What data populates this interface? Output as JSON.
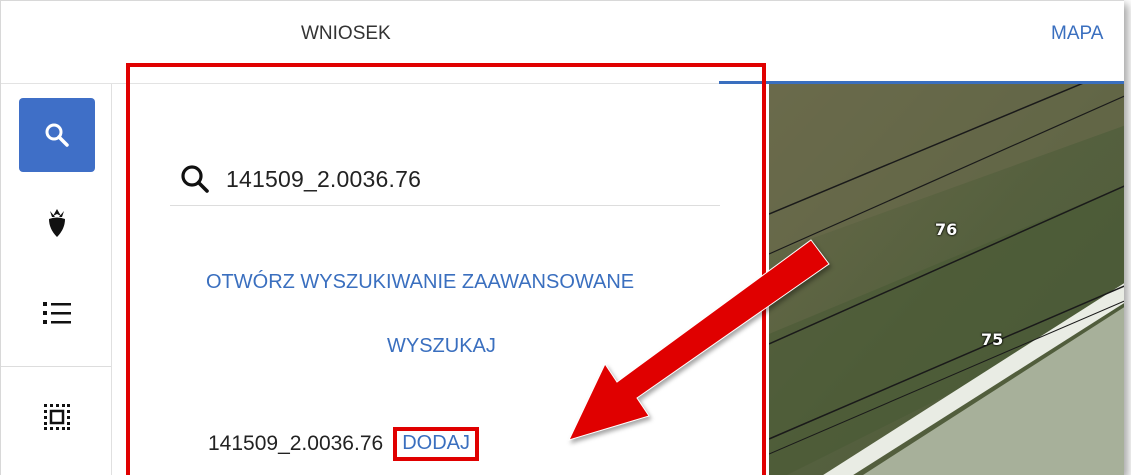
{
  "tabs": [
    {
      "label": "WNIOSEK",
      "active": false
    },
    {
      "label": "MAPA",
      "active": true
    }
  ],
  "sidebar": {
    "items": [
      {
        "icon": "search-icon",
        "active": true
      },
      {
        "icon": "beet-icon",
        "active": false
      },
      {
        "icon": "list-icon",
        "active": false
      },
      {
        "icon": "select-area-icon",
        "active": false
      }
    ]
  },
  "search": {
    "value": "141509_2.0036.76"
  },
  "links": {
    "advanced_search": "OTWÓRZ WYSZUKIWANIE ZAAWANSOWANE",
    "search": "WYSZUKAJ"
  },
  "result": {
    "id": "141509_2.0036.76",
    "add_label": "DODAJ"
  },
  "map": {
    "parcel_labels": [
      "76",
      "75"
    ]
  },
  "colors": {
    "accent": "#3a6fbf",
    "highlight": "#e00000",
    "active_button": "#3f6fc7"
  }
}
